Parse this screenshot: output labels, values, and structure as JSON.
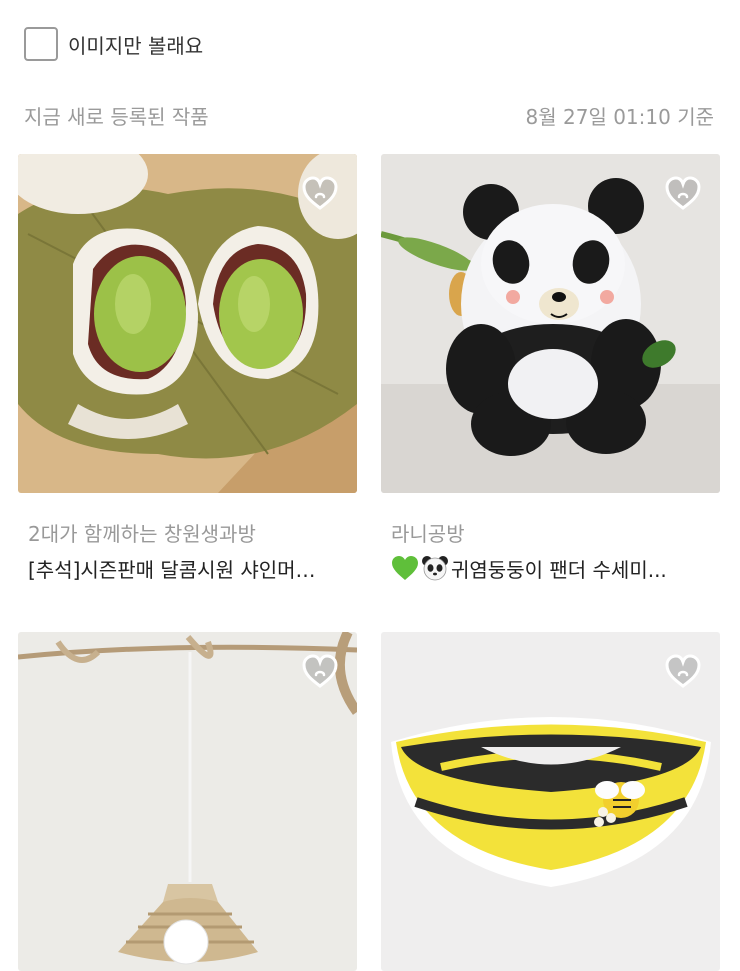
{
  "filter": {
    "label": "이미지만 볼래요",
    "checked": false
  },
  "info": {
    "heading": "지금 새로 등록된 작품",
    "timestamp": "8월 27일 01:10 기준"
  },
  "products": [
    {
      "shop": "2대가 함께하는 창원생과방",
      "title": "[추석]시즌판매 달콤시원 샤인머…",
      "image": "shine-muscat-rice-cake",
      "favorited": false
    },
    {
      "shop": "라니공방",
      "title": "귀염둥둥이 팬더 수세미...",
      "title_icons": [
        "green-heart-icon",
        "panda-face-icon"
      ],
      "image": "crochet-panda-doll",
      "favorited": false
    },
    {
      "shop": "",
      "title": "",
      "image": "rattan-pendant-lamp",
      "favorited": false
    },
    {
      "shop": "",
      "title": "",
      "image": "crochet-bee-collar",
      "favorited": false
    }
  ]
}
